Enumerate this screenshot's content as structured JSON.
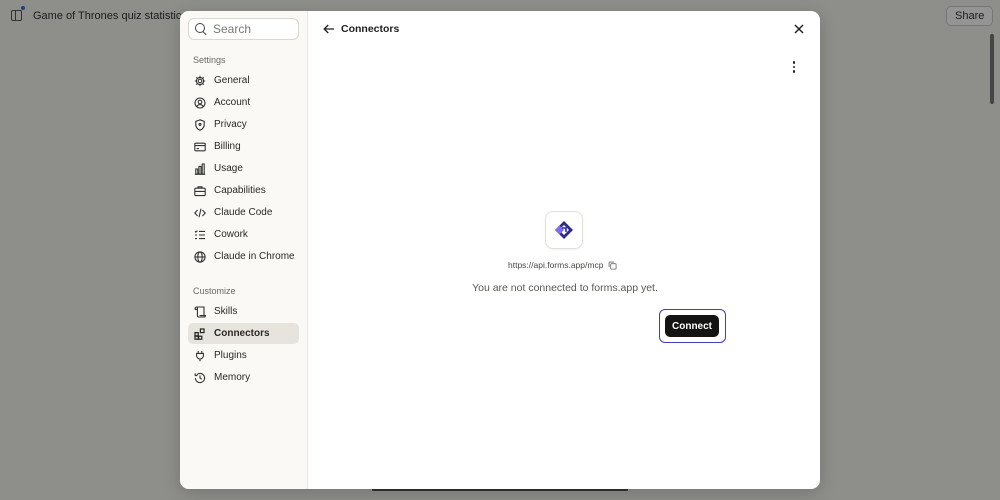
{
  "background": {
    "chat_title": "Game of Thrones quiz statistics a",
    "share_label": "Share"
  },
  "settings": {
    "search": {
      "placeholder": "Search",
      "value": ""
    },
    "sections": [
      {
        "title": "Settings",
        "items": [
          {
            "label": "General",
            "icon": "gear-icon"
          },
          {
            "label": "Account",
            "icon": "user-circle-icon"
          },
          {
            "label": "Privacy",
            "icon": "shield-icon"
          },
          {
            "label": "Billing",
            "icon": "credit-card-icon"
          },
          {
            "label": "Usage",
            "icon": "bar-chart-icon"
          },
          {
            "label": "Capabilities",
            "icon": "briefcase-icon"
          },
          {
            "label": "Claude Code",
            "icon": "code-icon"
          },
          {
            "label": "Cowork",
            "icon": "checklist-icon"
          },
          {
            "label": "Claude in Chrome",
            "icon": "globe-icon"
          }
        ]
      },
      {
        "title": "Customize",
        "items": [
          {
            "label": "Skills",
            "icon": "scroll-icon"
          },
          {
            "label": "Connectors",
            "icon": "blocks-icon",
            "active": true
          },
          {
            "label": "Plugins",
            "icon": "plug-icon"
          },
          {
            "label": "Memory",
            "icon": "history-icon"
          }
        ]
      }
    ]
  },
  "panel": {
    "title": "Connectors",
    "connector": {
      "url": "https://api.forms.app/mcp",
      "status": "You are not connected to forms.app yet.",
      "connect_label": "Connect",
      "brand_color_dark": "#2d2a8f",
      "brand_color_light": "#7c6cf0"
    }
  },
  "colors": {
    "focus_ring": "#3d3fbf",
    "button_bg": "#141413",
    "active_item_bg": "#e6e4dd"
  }
}
